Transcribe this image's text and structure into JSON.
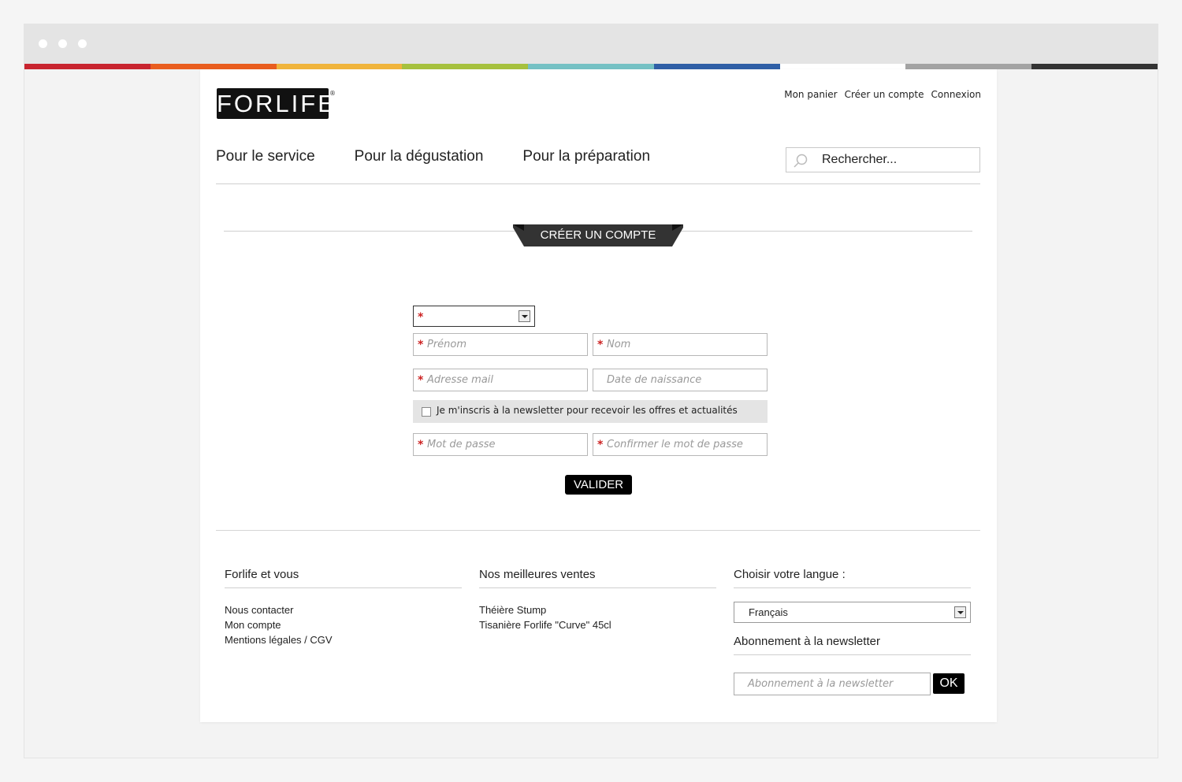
{
  "brand": {
    "logo_text": "FORLIFE",
    "registered_mark": "®"
  },
  "colors": {
    "stripe": [
      "#c8242f",
      "#e95d1e",
      "#f0b43c",
      "#a6c13e",
      "#75c1c4",
      "#2f5fa6",
      "#ffffff",
      "#a3a3a3",
      "#333333"
    ],
    "accent_required": "#cc2222",
    "button_bg": "#000000"
  },
  "header": {
    "top_links": [
      "Mon panier",
      "Créer un compte",
      "Connexion"
    ],
    "nav": [
      "Pour le service",
      "Pour la dégustation",
      "Pour la préparation"
    ],
    "search": {
      "placeholder": "Rechercher...",
      "icon": "search-icon"
    }
  },
  "page_title": "CRÉER UN COMPTE",
  "form": {
    "civility_select": {
      "selected": "",
      "required_mark": "*"
    },
    "required_mark": "*",
    "first_name": {
      "placeholder": "Prénom"
    },
    "last_name": {
      "placeholder": "Nom"
    },
    "email": {
      "placeholder": "Adresse mail"
    },
    "birth_date": {
      "placeholder": "Date de naissance"
    },
    "newsletter_checkbox": {
      "label": "Je m'inscris à la newsletter pour recevoir les offres et actualités",
      "checked": false
    },
    "password": {
      "placeholder": "Mot de passe"
    },
    "password_confirm": {
      "placeholder": "Confirmer le mot de passe"
    },
    "submit_label": "VALIDER"
  },
  "footer": {
    "col1": {
      "title": "Forlife et vous",
      "links": [
        "Nous contacter",
        "Mon compte",
        "Mentions légales / CGV"
      ]
    },
    "col2": {
      "title": "Nos meilleures ventes",
      "links": [
        "Théière Stump",
        "Tisanière Forlife \"Curve\" 45cl"
      ]
    },
    "col3": {
      "title": "Choisir votre langue :",
      "language_selected": "Français",
      "newsletter_title": "Abonnement à la newsletter",
      "newsletter_placeholder": "Abonnement à la newsletter",
      "ok_label": "OK"
    }
  }
}
